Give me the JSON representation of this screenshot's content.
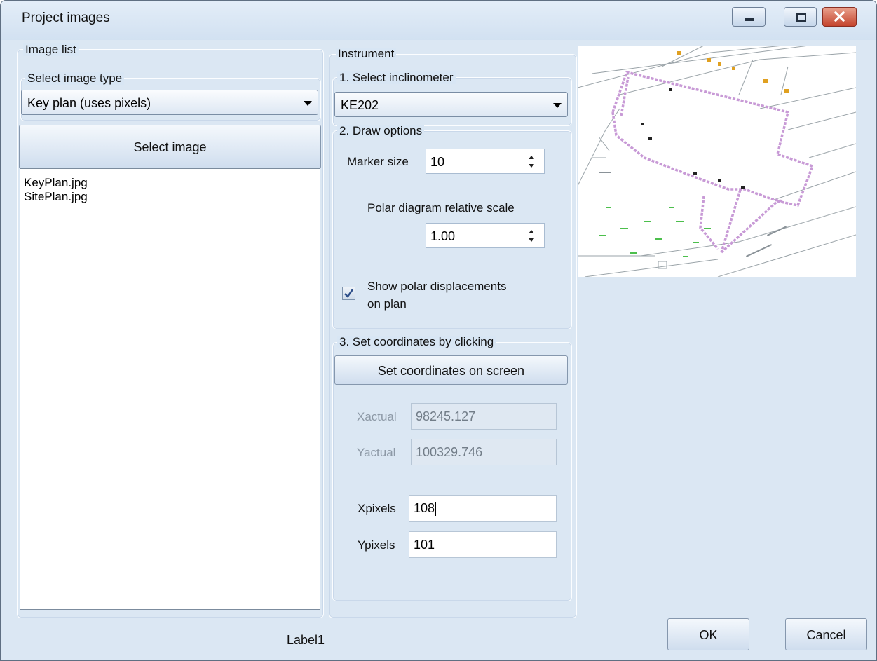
{
  "window": {
    "title": "Project images"
  },
  "image_list": {
    "group_label": "Image list",
    "type_group_label": "Select image type",
    "type_selected": "Key plan (uses pixels)",
    "select_button": "Select image",
    "files": [
      "KeyPlan.jpg",
      "SitePlan.jpg"
    ]
  },
  "instrument": {
    "group_label": "Instrument",
    "select_group_label": "1. Select inclinometer",
    "selected": "KE202"
  },
  "draw_options": {
    "group_label": "2. Draw options",
    "marker_size_label": "Marker size",
    "marker_size": "10",
    "polar_scale_label": "Polar diagram relative scale",
    "polar_scale": "1.00",
    "show_polar_label_line1": "Show polar displacements",
    "show_polar_label_line2": "on plan",
    "show_polar_checked": true
  },
  "coordinates": {
    "group_label": "3. Set coordinates by clicking",
    "set_button": "Set coordinates on screen",
    "xactual_label": "Xactual",
    "xactual": "98245.127",
    "yactual_label": "Yactual",
    "yactual": "100329.746",
    "xpixels_label": "Xpixels",
    "xpixels": "108",
    "ypixels_label": "Ypixels",
    "ypixels": "101"
  },
  "footer": {
    "status_label": "Label1",
    "ok": "OK",
    "cancel": "Cancel"
  },
  "colors": {
    "window_bg": "#d8e6f4",
    "close_button": "#c4432c",
    "plan_outline": "#c89ad6"
  }
}
